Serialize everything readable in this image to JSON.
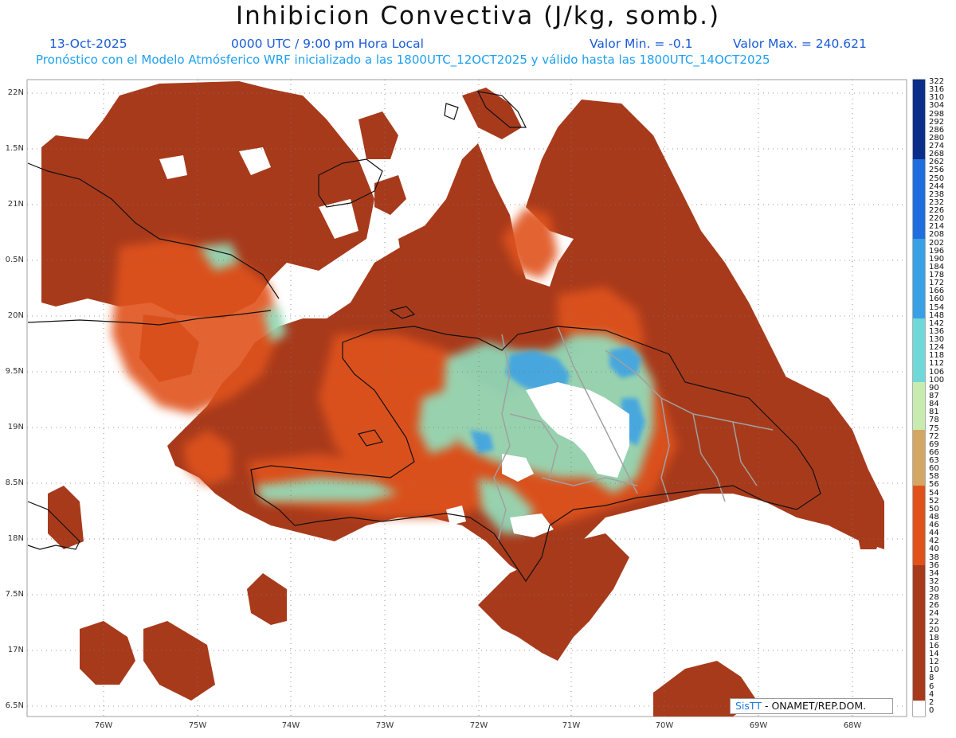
{
  "header": {
    "title": "Inhibicion Convectiva (J/kg, somb.)",
    "date": "13-Oct-2025",
    "time": "0000 UTC / 9:00 pm Hora Local",
    "valor_min": "Valor Min. = -0.1",
    "valor_max": "Valor Max. = 240.621",
    "subtitle": "Pronóstico con el Modelo Atmósferico WRF inicializado a las 1800UTC_12OCT2025 y válido hasta las  1800UTC_14OCT2025",
    "date_color": "#1a5bd6",
    "subtitle_color": "#1ea0f0"
  },
  "axes": {
    "lat_labels": [
      "22N",
      "1.5N",
      "21N",
      "0.5N",
      "20N",
      "9.5N",
      "19N",
      "8.5N",
      "18N",
      "7.5N",
      "17N",
      "6.5N"
    ],
    "lon_labels": [
      "76W",
      "75W",
      "74W",
      "73W",
      "72W",
      "71W",
      "70W",
      "69W",
      "68W"
    ]
  },
  "colorbar": {
    "labels": [
      "322",
      "316",
      "310",
      "304",
      "298",
      "292",
      "286",
      "280",
      "274",
      "268",
      "262",
      "256",
      "250",
      "244",
      "238",
      "232",
      "226",
      "220",
      "214",
      "208",
      "202",
      "196",
      "190",
      "184",
      "178",
      "172",
      "166",
      "160",
      "154",
      "148",
      "142",
      "136",
      "130",
      "124",
      "118",
      "112",
      "106",
      "100",
      "90",
      "87",
      "84",
      "81",
      "78",
      "75",
      "72",
      "69",
      "66",
      "63",
      "60",
      "58",
      "56",
      "54",
      "52",
      "50",
      "48",
      "46",
      "44",
      "42",
      "40",
      "38",
      "36",
      "34",
      "32",
      "30",
      "28",
      "26",
      "24",
      "22",
      "20",
      "18",
      "16",
      "14",
      "12",
      "10",
      "8",
      "6",
      "4",
      "2",
      "0"
    ]
  },
  "credit": {
    "brand": "SisTT",
    "text": "- ONAMET/REP.DOM."
  },
  "colors": {
    "field_base": "#a83a1c",
    "field_mid": "#e0521a",
    "field_high": "#8de8c8",
    "field_peak": "#3aa0e6",
    "coast": "#111111",
    "borders": "#a0a0a0"
  }
}
